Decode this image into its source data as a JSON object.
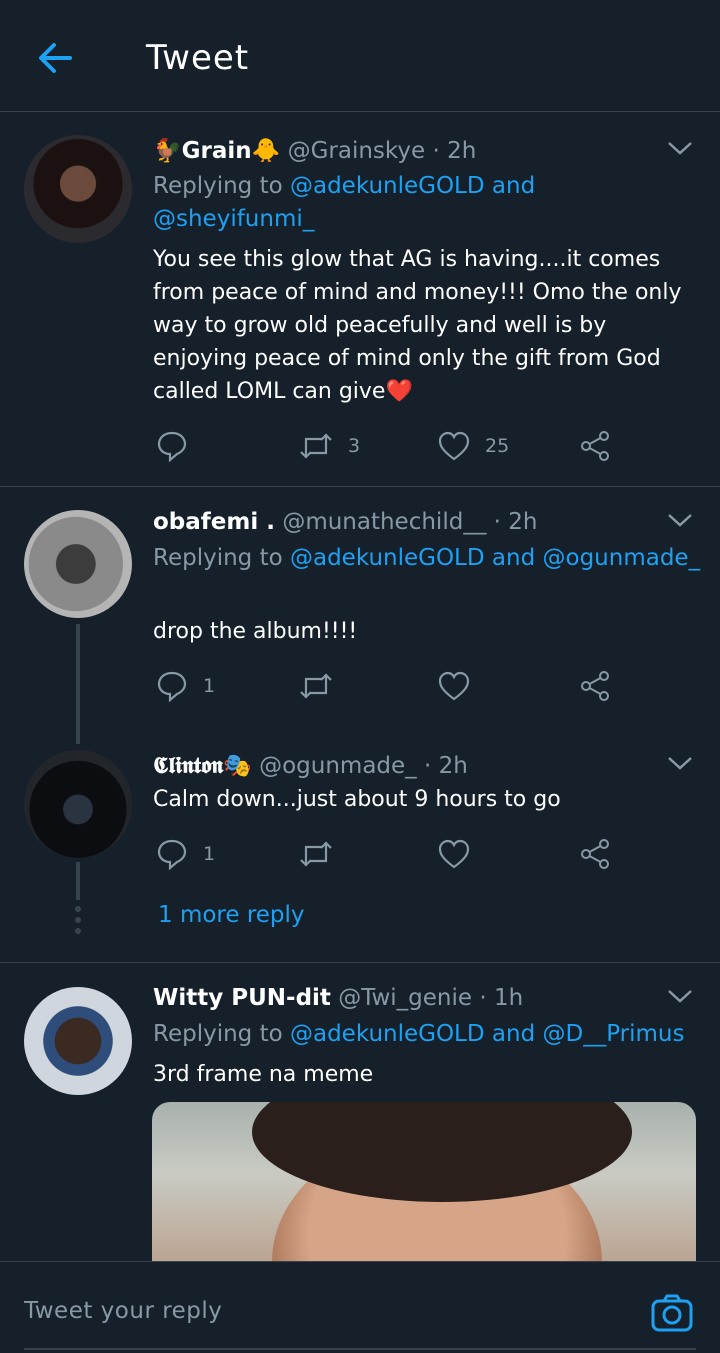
{
  "header": {
    "title": "Tweet"
  },
  "tweets": [
    {
      "name_prefix": "🐓",
      "display_name": "Grain",
      "name_suffix": "🐥",
      "handle": "@Grainskye",
      "time": "· 2h",
      "replying_prefix": "Replying to",
      "replying_mention_1": "@adekunleGOLD",
      "replying_and": "and",
      "replying_mention_2": "@sheyifunmi_",
      "text": "You see this glow that AG is having....it comes from peace of mind and money!!! Omo the only way to grow old peacefully and well is by enjoying peace of mind only the gift from God called LOML can give❤️",
      "retweets": "3",
      "likes": "25"
    },
    {
      "display_name": "obafemi .",
      "handle": "@munathechild__",
      "time": "· 2h",
      "replying_prefix": "Replying to",
      "replying_mention_1": "@adekunleGOLD",
      "replying_and": "and",
      "replying_mention_2": "@ogunmade_",
      "text": "drop the album!!!!",
      "replies": "1"
    },
    {
      "display_name": "𝕮𝖑𝖎𝖓𝖙𝖔𝖓",
      "name_suffix": "🎭",
      "handle": "@ogunmade_",
      "time": "· 2h",
      "text": "Calm down...just about 9 hours to go",
      "replies": "1"
    },
    {
      "display_name": "Witty PUN-dit",
      "handle": "@Twi_genie",
      "time": "· 1h",
      "replying_prefix": "Replying to",
      "replying_mention_1": "@adekunleGOLD",
      "replying_and": "and",
      "replying_mention_2": "@D__Primus",
      "text": "3rd frame na meme"
    }
  ],
  "thread": {
    "more_replies": "1 more reply"
  },
  "reply_bar": {
    "placeholder": "Tweet your reply"
  },
  "colors": {
    "background": "#15202b",
    "accent": "#1da1f2",
    "secondary_text": "#8899a6",
    "divider": "#38444d"
  }
}
